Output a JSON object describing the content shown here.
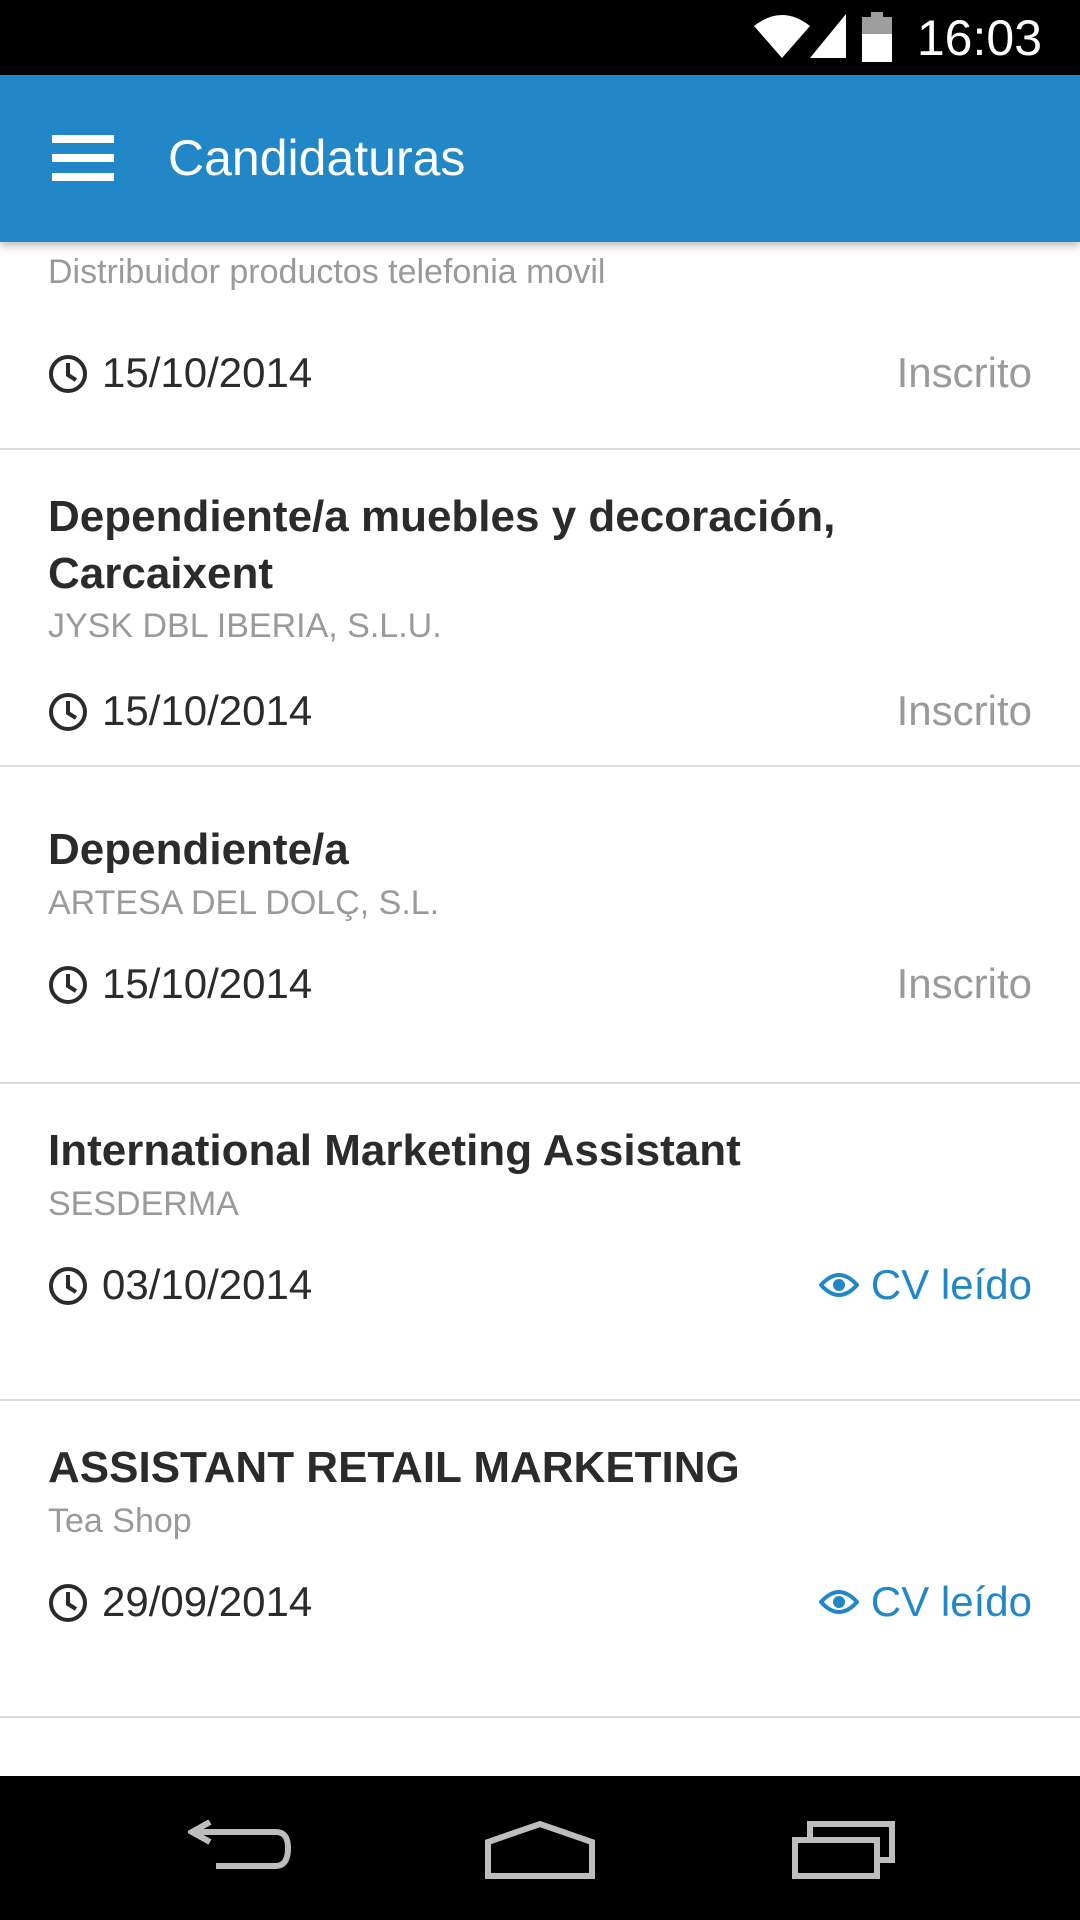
{
  "status_bar": {
    "time": "16:03",
    "icons": [
      "wifi-icon",
      "signal-icon",
      "battery-icon"
    ]
  },
  "app_bar": {
    "menu_icon": "hamburger-menu-icon",
    "title": "Candidaturas",
    "color": "#2287c6"
  },
  "applications": [
    {
      "title": "",
      "company": "Distribuidor productos telefonia movil",
      "date": "15/10/2014",
      "status": "Inscrito",
      "status_icon": ""
    },
    {
      "title": "Dependiente/a muebles y decoración, Carcaixent",
      "company": "JYSK DBL IBERIA, S.L.U.",
      "date": "15/10/2014",
      "status": "Inscrito",
      "status_icon": ""
    },
    {
      "title": "Dependiente/a",
      "company": "ARTESA DEL DOLÇ, S.L.",
      "date": "15/10/2014",
      "status": "Inscrito",
      "status_icon": ""
    },
    {
      "title": "International Marketing Assistant",
      "company": "SESDERMA",
      "date": "03/10/2014",
      "status": "CV leído",
      "status_icon": "eye-icon"
    },
    {
      "title": "ASSISTANT RETAIL MARKETING",
      "company": "Tea Shop",
      "date": "29/09/2014",
      "status": "CV leído",
      "status_icon": "eye-icon"
    }
  ],
  "nav_bar": {
    "buttons": [
      "back-icon",
      "home-icon",
      "recents-icon"
    ]
  }
}
